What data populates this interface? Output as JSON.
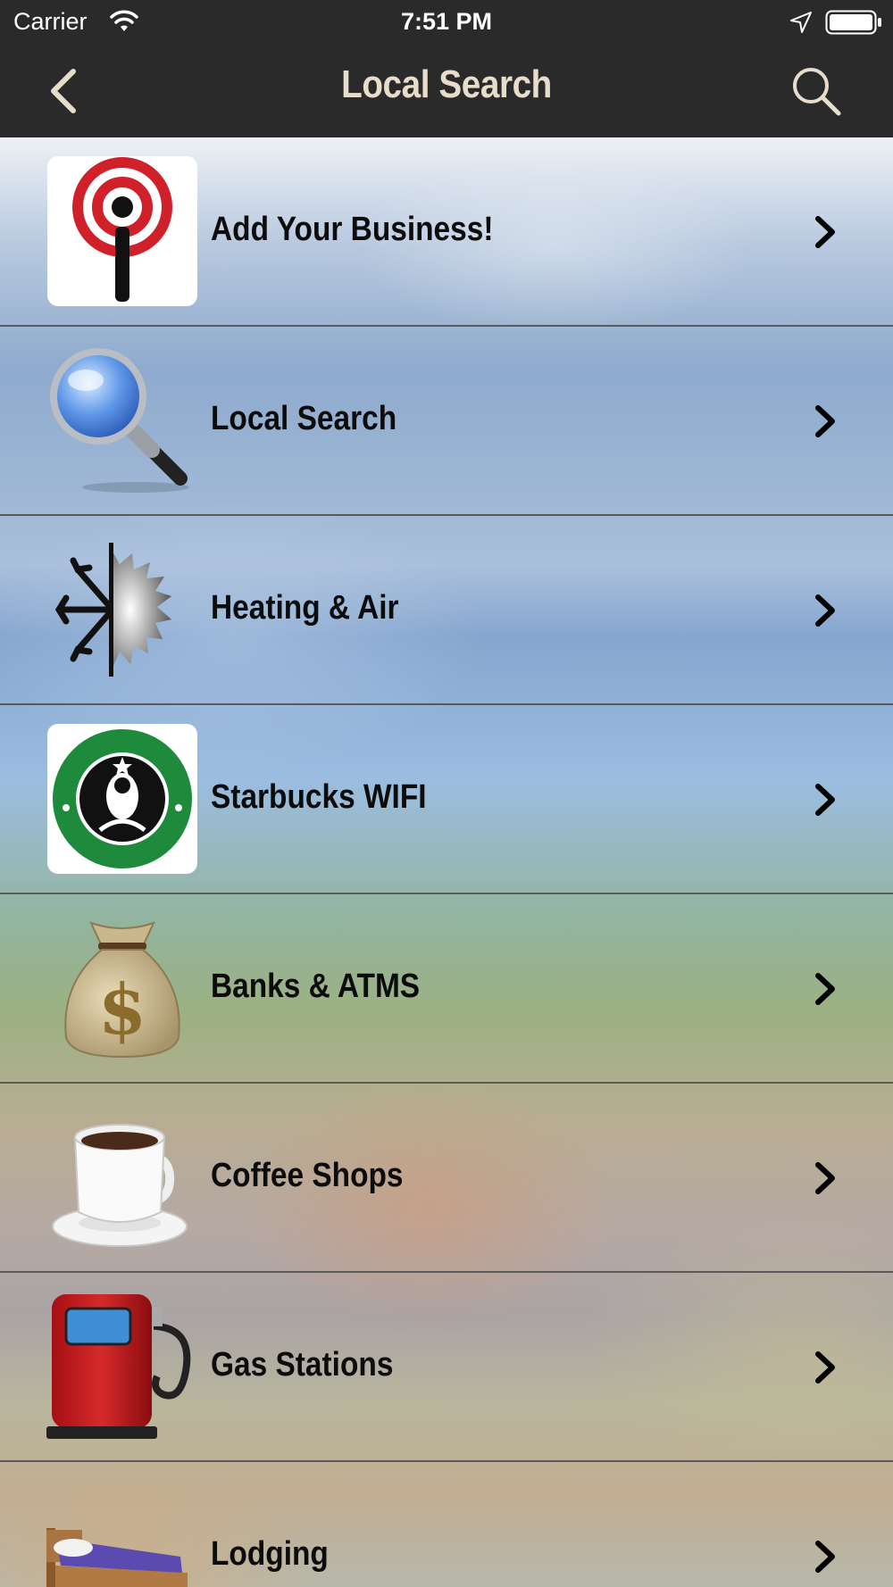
{
  "status_bar": {
    "carrier": "Carrier",
    "time": "7:51 PM"
  },
  "nav": {
    "title": "Local Search",
    "back_icon": "chevron-left-icon",
    "search_icon": "search-icon"
  },
  "list": {
    "items": [
      {
        "label": "Add Your Business!",
        "icon": "broadcast-info-icon"
      },
      {
        "label": "Local Search",
        "icon": "magnifying-glass-icon"
      },
      {
        "label": "Heating & Air",
        "icon": "snowflake-sun-icon"
      },
      {
        "label": "Starbucks WIFI",
        "icon": "starbucks-logo-icon"
      },
      {
        "label": "Banks & ATMS",
        "icon": "money-bag-icon"
      },
      {
        "label": "Coffee Shops",
        "icon": "coffee-cup-icon"
      },
      {
        "label": "Gas Stations",
        "icon": "gas-pump-icon"
      },
      {
        "label": "Lodging",
        "icon": "bed-icon"
      }
    ]
  },
  "colors": {
    "nav_background": "#2a2a2a",
    "title_color": "#e8dccb",
    "row_separator": "#5a5a5a"
  }
}
